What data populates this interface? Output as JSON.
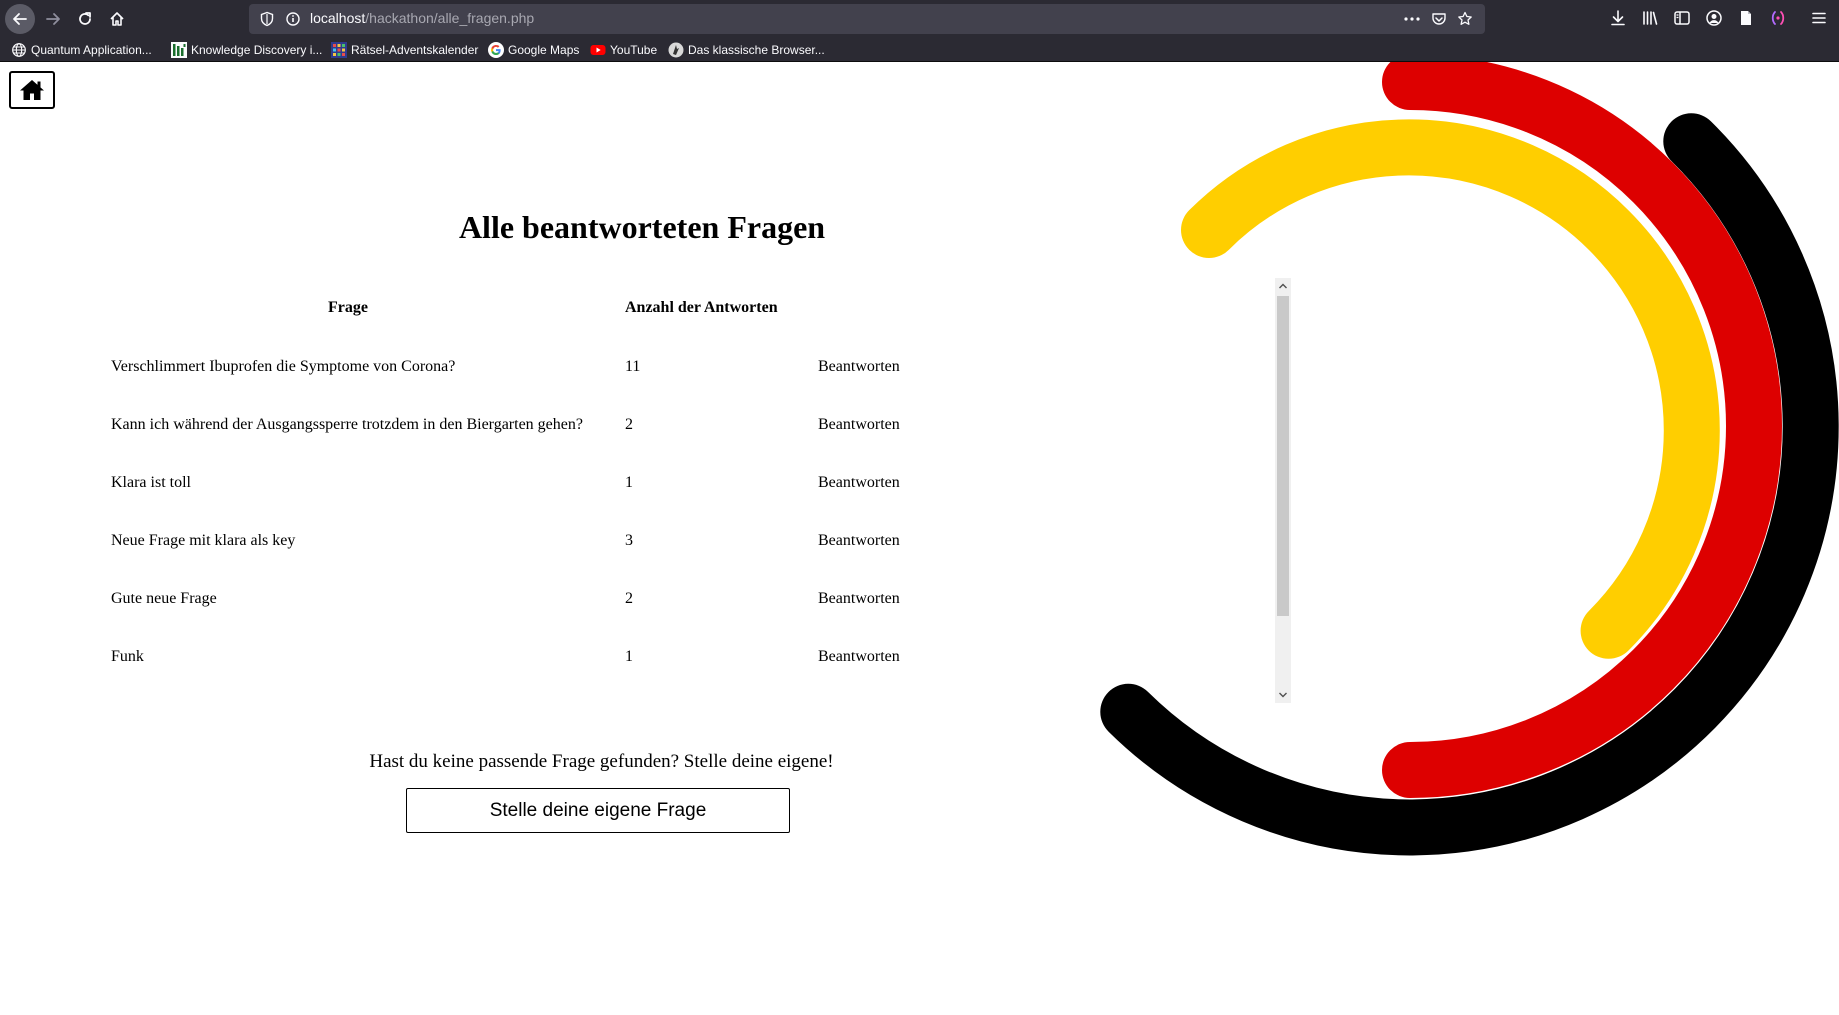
{
  "browser": {
    "url_host": "localhost",
    "url_path": "/hackathon/alle_fragen.php",
    "bookmarks": [
      {
        "label": "Quantum Application...",
        "icon": "globe-icon"
      },
      {
        "label": "Knowledge Discovery i...",
        "icon": "kd-favicon"
      },
      {
        "label": "Rätsel-Adventskalender",
        "icon": "calendar-favicon"
      },
      {
        "label": "Google Maps",
        "icon": "google-icon"
      },
      {
        "label": "YouTube",
        "icon": "youtube-icon"
      },
      {
        "label": "Das klassische Browser...",
        "icon": "game-favicon"
      }
    ]
  },
  "page": {
    "title": "Alle beantworteten Fragen",
    "table": {
      "headers": [
        "Frage",
        "Anzahl der Antworten"
      ],
      "rows": [
        {
          "question": "Verschlimmert Ibuprofen die Symptome von Corona?",
          "count": "11",
          "action": "Beantworten"
        },
        {
          "question": "Kann ich während der Ausgangssperre trotzdem in den Biergarten gehen?",
          "count": "2",
          "action": "Beantworten"
        },
        {
          "question": "Klara ist toll",
          "count": "1",
          "action": "Beantworten"
        },
        {
          "question": "Neue Frage mit klara als key",
          "count": "3",
          "action": "Beantworten"
        },
        {
          "question": "Gute neue Frage",
          "count": "2",
          "action": "Beantworten"
        },
        {
          "question": "Funk",
          "count": "1",
          "action": "Beantworten"
        }
      ]
    },
    "cta_text": "Hast du keine passende Frage gefunden? Stelle deine eigene!",
    "cta_button": "Stelle deine eigene Frage"
  },
  "colors": {
    "arc_black": "#000000",
    "arc_red": "#dd0000",
    "arc_gold": "#ffce00",
    "chrome_bg": "#2b2a33",
    "urlbar_bg": "#42414d"
  }
}
